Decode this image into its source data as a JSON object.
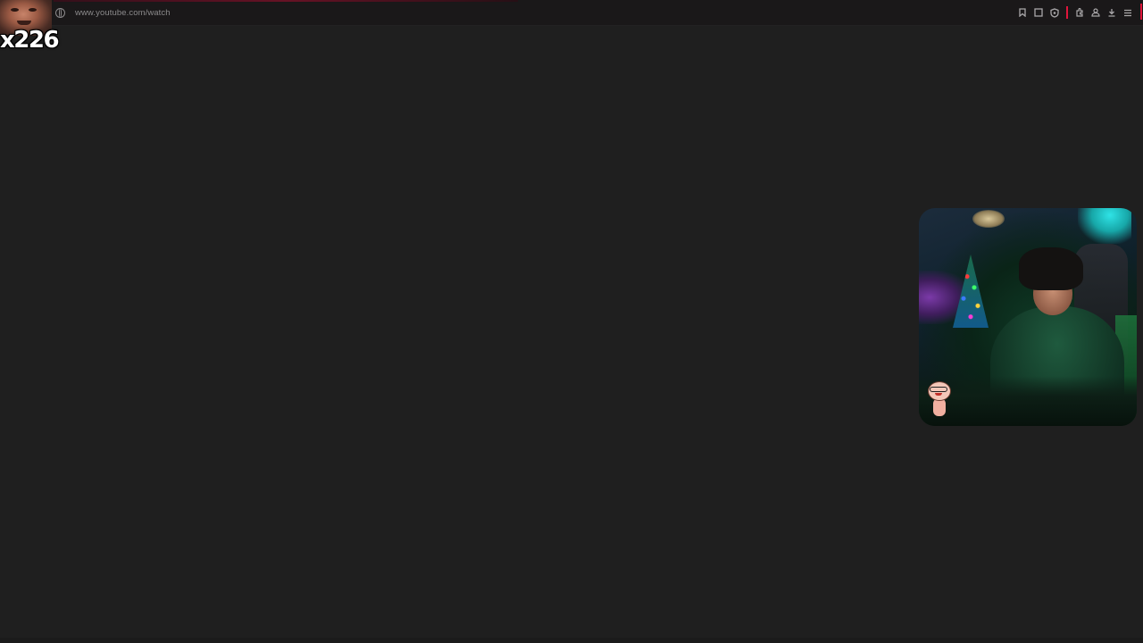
{
  "browser": {
    "url": "www.youtube.com/watch",
    "toolbar_icons": [
      "bookmark-icon",
      "reading-list-icon",
      "shield-icon",
      "extensions-icon",
      "profile-lock-icon",
      "download-icon",
      "menu-icon"
    ]
  },
  "overlay": {
    "counter_text": "x226"
  },
  "colors": {
    "page_background": "#1f1f1f",
    "toolbar_background": "#1a1819",
    "url_text": "#8b8a8b",
    "accent_red": "#e0153b"
  }
}
